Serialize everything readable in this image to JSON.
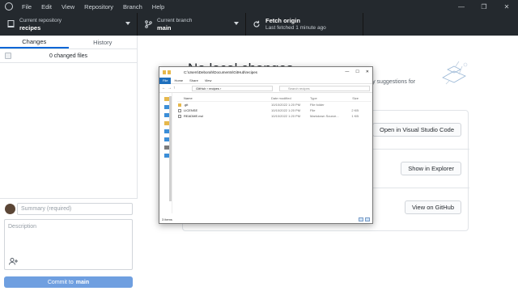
{
  "titlebar": {
    "menu": [
      "File",
      "Edit",
      "View",
      "Repository",
      "Branch",
      "Help"
    ],
    "window_controls": [
      "—",
      "❐",
      "✕"
    ]
  },
  "toolbar": {
    "repo": {
      "label": "Current repository",
      "value": "recipes"
    },
    "branch": {
      "label": "Current branch",
      "value": "main"
    },
    "fetch": {
      "label": "Fetch origin",
      "value": "Last fetched 1 minute ago"
    }
  },
  "sidebar": {
    "tabs": [
      "Changes",
      "History"
    ],
    "changed_files": "0 changed files",
    "summary_placeholder": "Summary (required)",
    "description_placeholder": "Description",
    "commit_prefix": "Commit to",
    "commit_branch": "main"
  },
  "main": {
    "heading": "No local changes",
    "suggestion": "lly suggestions for",
    "actions": [
      "Open in Visual Studio Code",
      "Show in Explorer",
      "View on GitHub"
    ]
  },
  "explorer": {
    "title_path": "C:\\Users\\Deborah\\Documents\\GitHub\\recipes",
    "ribbon_tabs": [
      "File",
      "Home",
      "Share",
      "View"
    ],
    "address": [
      "GitHub",
      "recipes"
    ],
    "search_placeholder": "Search recipes",
    "columns": [
      "Name",
      "Date modified",
      "Type",
      "Size"
    ],
    "files": [
      {
        "name": ".git",
        "date": "10/10/2022 1:20 PM",
        "type": "File folder",
        "size": ""
      },
      {
        "name": "LICENSE",
        "date": "10/10/2022 1:20 PM",
        "type": "File",
        "size": "2 KB"
      },
      {
        "name": "README.md",
        "date": "10/10/2022 1:20 PM",
        "type": "Markdown Source...",
        "size": "1 KB"
      }
    ],
    "status": "3 items"
  }
}
